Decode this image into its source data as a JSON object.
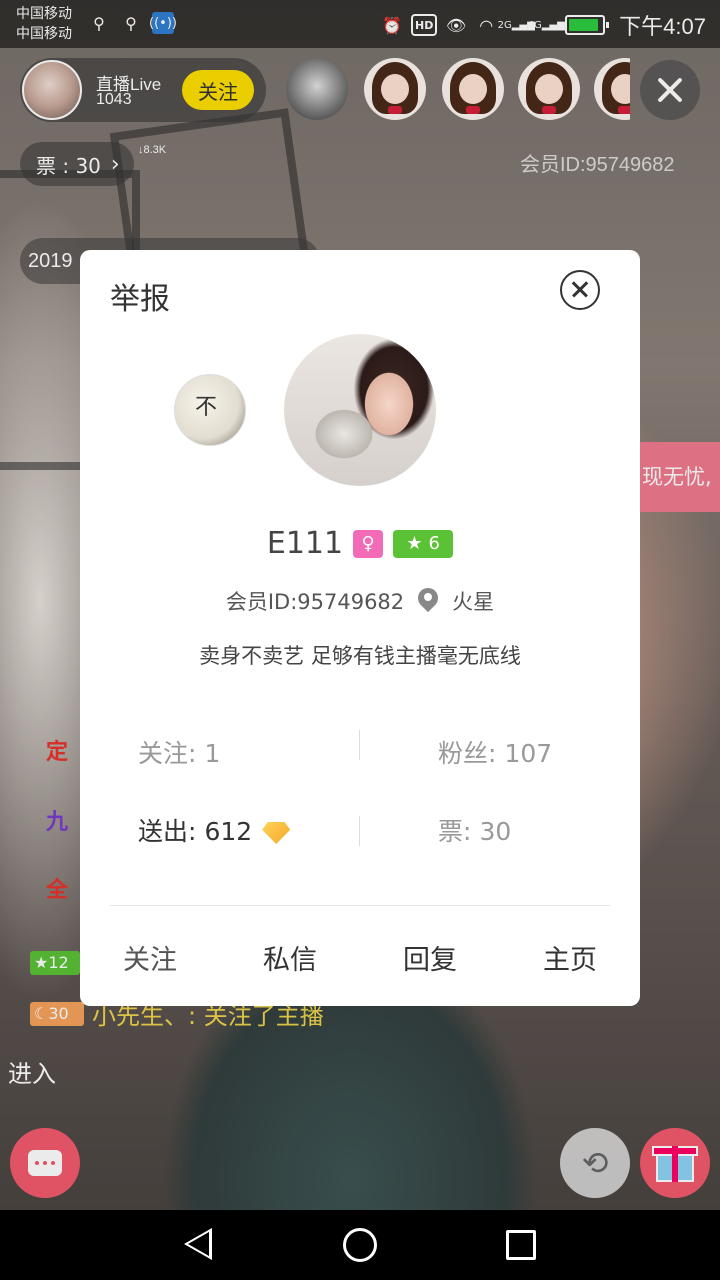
{
  "status_bar": {
    "carrier1": "中国移动",
    "carrier2": "中国移动",
    "icons_left": [
      "usb-icon",
      "usb-icon",
      "hotspot-icon"
    ],
    "icons_right": [
      "alarm-icon",
      "hd-icon",
      "eye-icon",
      "wifi-icon",
      "signal-2g-icon",
      "signal-4g-icon",
      "battery-icon"
    ],
    "net1": "2G",
    "net2": "4G",
    "time": "下午4:07",
    "battery_level": 0.8
  },
  "header": {
    "host_name": "直播Live",
    "host_count": "1043",
    "follow_label": "关注",
    "votes_label": "票 : 30",
    "small_stat": "↓8.3K",
    "member_id": "会员ID:95749682",
    "viewers": [
      "viewer-1",
      "viewer-2",
      "viewer-3",
      "viewer-4",
      "viewer-5"
    ]
  },
  "feed": {
    "date_prefix": "2019",
    "pink_banner": "现无忧,",
    "line1": "定",
    "line2": "九",
    "line3": "全",
    "green_badge": "★12",
    "orange_badge": "☾30",
    "bottom_line": "小先生、: 关注了主播",
    "enter_text": "进入"
  },
  "modal": {
    "title": "举报",
    "side_avatar_text": "不",
    "username": "E111",
    "gender_symbol": "♀",
    "level": "6",
    "member_id": "会员ID:95749682",
    "location": "火星",
    "signature": "卖身不卖艺 足够有钱主播毫无底线",
    "following_label": "关注:",
    "following_value": "1",
    "fans_label": "粉丝:",
    "fans_value": "107",
    "sent_label": "送出:",
    "sent_value": "612",
    "votes_label": "票:",
    "votes_value": "30",
    "actions": {
      "follow": "关注",
      "message": "私信",
      "reply": "回复",
      "home": "主页"
    }
  },
  "colors": {
    "follow_yellow": "#ffe000",
    "pink_accent": "#f35b6d",
    "level_green": "#5bc236",
    "gender_pink": "#f36bb6"
  }
}
